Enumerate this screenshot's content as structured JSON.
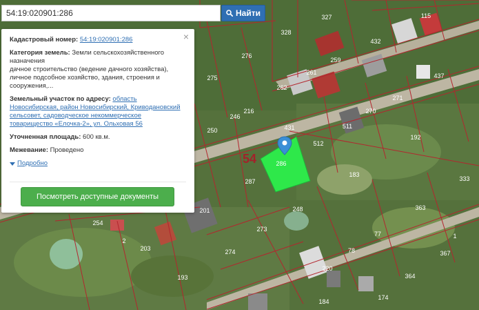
{
  "search": {
    "query": "54:19:020901:286",
    "button_label": "Найти"
  },
  "info": {
    "cadastral_label": "Кадастровый номер:",
    "cadastral_number": "54:19:020901:286",
    "land_category_label": "Категория земель:",
    "land_category_value": "Земли сельскохозяйственного назначения",
    "land_use_text": "дачное строительство (ведение дачного хозяйства), личное подсобное хозяйство, здания, строения и сооружения,...",
    "address_label": "Земельный участок по адресу:",
    "address_value": "область Новосибирская, район Новосибирский, Криводановский сельсовет, садоводческое некоммерческое товарищество «Елочка-2», ул. Ольховая 56",
    "area_label": "Уточненная площадь:",
    "area_value": "600 кв.м.",
    "survey_label": "Межевание:",
    "survey_value": "Проведено",
    "more_link": "Подробно",
    "docs_button": "Посмотреть доступные документы",
    "close_glyph": "×"
  },
  "map": {
    "block_number": "54",
    "highlight_color": "#2ee84a",
    "boundary_color": "#b3262e",
    "plot_labels": [
      "327",
      "115",
      "328",
      "432",
      "276",
      "261",
      "259",
      "275",
      "262",
      "437",
      "271",
      "246",
      "216",
      "270",
      "250",
      "431",
      "511",
      "512",
      "192",
      "287",
      "183",
      "333",
      "201",
      "248",
      "363",
      "273",
      "77",
      "203",
      "274",
      "78",
      "1",
      "367",
      "193",
      "220",
      "364",
      "174",
      "184",
      "254",
      "2",
      "286"
    ]
  },
  "icons": {
    "search": "search-icon",
    "marker": "map-marker-icon",
    "close": "close-icon",
    "expand": "triangle-down-icon"
  }
}
